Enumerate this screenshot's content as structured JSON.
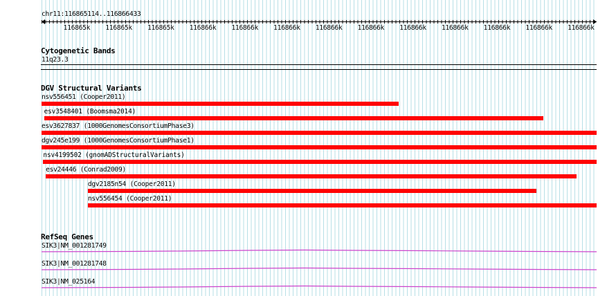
{
  "ruler": {
    "location": "chr11:116865114..116866433",
    "ticks": [
      "116865k",
      "116865k",
      "116865k",
      "116866k",
      "116866k",
      "116866k",
      "116866k",
      "116866k",
      "116866k",
      "116866k",
      "116866k",
      "116866k",
      "116866k"
    ]
  },
  "tracks": {
    "cytoband": {
      "title": "Cytogenetic Bands",
      "band": "11q23.3"
    },
    "dgv": {
      "title": "DGV Structural Variants",
      "features": [
        {
          "label": "nsv556451 (Cooper2011)",
          "start": 116865114,
          "end": 116865962
        },
        {
          "label": "esv3548401 (Boomsma2014)",
          "start": 116865120,
          "end": 116866306
        },
        {
          "label": "esv3627837 (1000GenomesConsortiumPhase3)",
          "start": 116865114,
          "end": 116866433
        },
        {
          "label": "dgv245e199 (1000GenomesConsortiumPhase1)",
          "start": 116865114,
          "end": 116866433
        },
        {
          "label": "nsv4199502 (gnomADStructuralVariants)",
          "start": 116865118,
          "end": 116866433
        },
        {
          "label": "esv24446 (Conrad2009)",
          "start": 116865124,
          "end": 116866386
        },
        {
          "label": "dgv2185n54 (Cooper2011)",
          "start": 116865224,
          "end": 116866290
        },
        {
          "label": "nsv556454 (Cooper2011)",
          "start": 116865224,
          "end": 116866433
        }
      ]
    },
    "refseq": {
      "title": "RefSeq Genes",
      "features": [
        {
          "label": "SIK3|NM_001281749"
        },
        {
          "label": "SIK3|NM_001281748"
        },
        {
          "label": "SIK3|NM_025164"
        }
      ]
    }
  },
  "colors": {
    "grid_line": "#b7dfe6",
    "variant": "#ff0000",
    "gene_intron": "#cc44cc",
    "text": "#000000"
  }
}
